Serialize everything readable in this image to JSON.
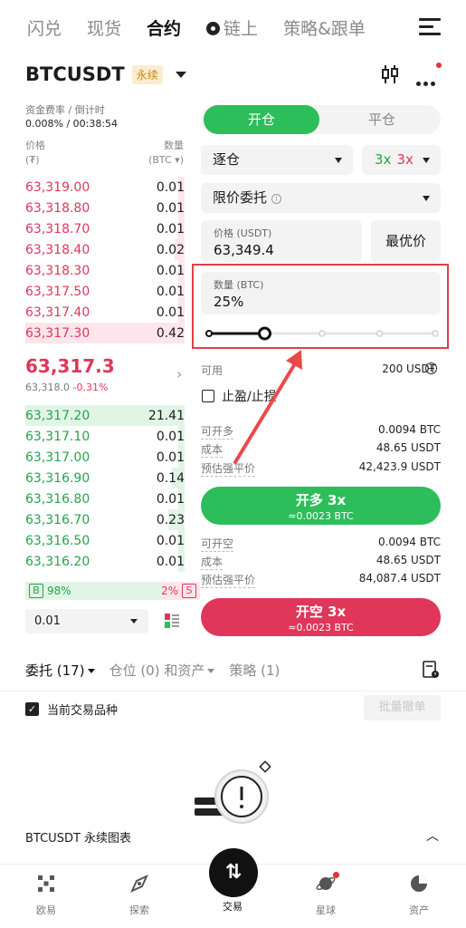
{
  "top_tabs": [
    "闪兑",
    "现货",
    "合约",
    "链上",
    "策略&跟单"
  ],
  "instrument": {
    "name": "BTCUSDT",
    "badge": "永续"
  },
  "funding": {
    "label": "资金费率 / 倒计时",
    "value": "0.008% / 00:38:54"
  },
  "orderbook": {
    "price_label": "价格",
    "price_unit": "(₮)",
    "qty_label": "数量",
    "qty_unit": "(BTC ▾)",
    "asks": [
      {
        "price": "63,319.00",
        "qty": "0.01",
        "depth": 0.04
      },
      {
        "price": "63,318.80",
        "qty": "0.01",
        "depth": 0.04
      },
      {
        "price": "63,318.70",
        "qty": "0.01",
        "depth": 0.04
      },
      {
        "price": "63,318.40",
        "qty": "0.02",
        "depth": 0.06
      },
      {
        "price": "63,318.30",
        "qty": "0.01",
        "depth": 0.04
      },
      {
        "price": "63,317.50",
        "qty": "0.01",
        "depth": 0.04
      },
      {
        "price": "63,317.40",
        "qty": "0.01",
        "depth": 0.04
      },
      {
        "price": "63,317.30",
        "qty": "0.42",
        "depth": 1.0
      }
    ],
    "last_price": "63,317.3",
    "mark_price": "63,318.0",
    "change": "-0.31%",
    "bids": [
      {
        "price": "63,317.20",
        "qty": "21.41",
        "depth": 1.0
      },
      {
        "price": "63,317.10",
        "qty": "0.01",
        "depth": 0.04
      },
      {
        "price": "63,317.00",
        "qty": "0.01",
        "depth": 0.04
      },
      {
        "price": "63,316.90",
        "qty": "0.14",
        "depth": 0.08
      },
      {
        "price": "63,316.80",
        "qty": "0.01",
        "depth": 0.04
      },
      {
        "price": "63,316.70",
        "qty": "0.23",
        "depth": 0.1
      },
      {
        "price": "63,316.50",
        "qty": "0.01",
        "depth": 0.04
      },
      {
        "price": "63,316.20",
        "qty": "0.01",
        "depth": 0.04
      }
    ],
    "buy_ratio": "98%",
    "sell_ratio": "2%",
    "buy_letter": "B",
    "sell_letter": "S",
    "precision": "0.01"
  },
  "order_form": {
    "open_tab": "开仓",
    "close_tab": "平仓",
    "margin_mode": "逐仓",
    "leverage_long": "3x",
    "leverage_short": "3x",
    "order_type": "限价委托",
    "price_label": "价格 (USDT)",
    "price_value": "63,349.4",
    "best_price": "最优价",
    "qty_label": "数量 (BTC)",
    "qty_value": "25%",
    "slider_fraction": 0.25,
    "available_label": "可用",
    "available_value": "200 USDT",
    "tpsl_label": "止盈/止损",
    "long": {
      "can_open_label": "可开多",
      "can_open_value": "0.0094 BTC",
      "cost_label": "成本",
      "cost_value": "48.65 USDT",
      "liq_label": "预估强平价",
      "liq_value": "42,423.9 USDT",
      "button": "开多 3x",
      "button_sub": "≈0.0023 BTC"
    },
    "short": {
      "can_open_label": "可开空",
      "can_open_value": "0.0094 BTC",
      "cost_label": "成本",
      "cost_value": "48.65 USDT",
      "liq_label": "预估强平价",
      "liq_value": "84,087.4 USDT",
      "button": "开空 3x",
      "button_sub": "≈0.0023 BTC"
    }
  },
  "lower_tabs": [
    "委托 (17)",
    "仓位 (0) 和资产",
    "策略 (1)"
  ],
  "current_only": "当前交易品种",
  "cancel_all": "批量撤单",
  "chart_bar": "BTCUSDT 永续图表",
  "bottom_nav": [
    "欧易",
    "探索",
    "交易",
    "星球",
    "资产"
  ],
  "colors": {
    "green": "#2dbd5a",
    "red": "#e0365a",
    "highlight": "#e0404a"
  }
}
